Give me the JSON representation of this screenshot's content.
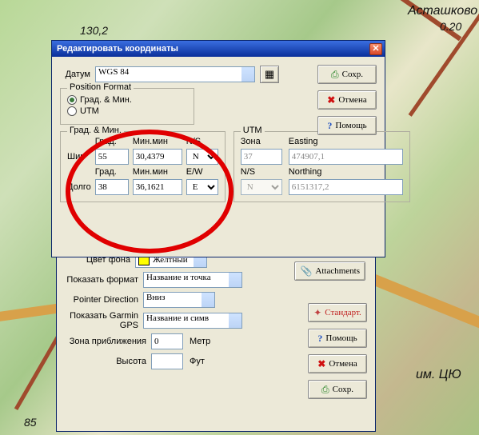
{
  "map_labels": {
    "town": "Асташково",
    "elev1": "130,2",
    "elev2": "0.20",
    "elev3": "85",
    "road_label": "им. ЦЮ"
  },
  "coordWin": {
    "title": "Редактировать координаты",
    "datum_label": "Датум",
    "datum_value": "WGS 84",
    "posformat_legend": "Position Format",
    "radio_degmin": "Град. & Мин.",
    "radio_utm": "UTM",
    "radio_selected": "degmin",
    "degmin": {
      "legend": "Град. & Мин.",
      "col_deg": "Град.",
      "col_min": "Мин.мин",
      "col_ns": "N/S",
      "col_ew": "E/W",
      "lat_label": "Шир",
      "lat_deg": "55",
      "lat_min": "30,4379",
      "lat_hemi": "N",
      "lon_label": "Долго",
      "lon_deg": "38",
      "lon_min": "36,1621",
      "lon_hemi": "E"
    },
    "utm": {
      "legend": "UTM",
      "zone_label": "Зона",
      "zone_value": "37",
      "easting_label": "Easting",
      "easting_value": "474907,1",
      "ns_label": "N/S",
      "ns_value": "N",
      "northing_label": "Northing",
      "northing_value": "6151317,2"
    },
    "buttons": {
      "save": "Сохр.",
      "cancel": "Отмена",
      "help": "Помощь"
    }
  },
  "wpWin": {
    "attachments_btn": "Attachments",
    "bgcolor_label": "Цвет фона",
    "bgcolor_value": "Желтный",
    "showformat_label": "Показать формат",
    "showformat_value": "Название и точка",
    "pointerdir_label": "Pointer Direction",
    "pointerdir_value": "Вниз",
    "showgarmin_label": "Показать Garmin GPS",
    "showgarmin_value": "Название и симв",
    "zoom_label": "Зона приближения",
    "zoom_value": "0",
    "zoom_unit": "Метр",
    "alt_label": "Высота",
    "alt_value": "",
    "alt_unit": "Фут",
    "buttons": {
      "defaults": "Стандарт.",
      "help": "Помощь",
      "cancel": "Отмена",
      "save": "Сохр."
    }
  }
}
